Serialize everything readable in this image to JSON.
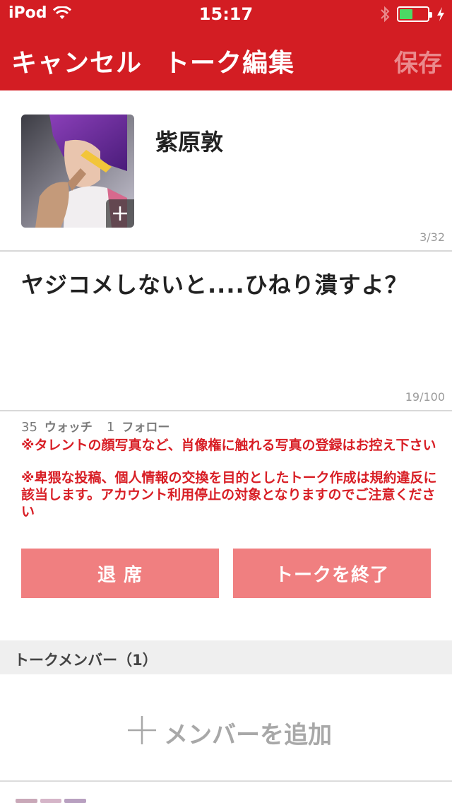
{
  "status_bar": {
    "carrier": "iPod",
    "time": "15:17",
    "wifi_icon": "wifi-icon",
    "bluetooth_icon": "bluetooth-icon",
    "battery_icon": "battery-icon",
    "charging_icon": "charging-bolt-icon"
  },
  "nav": {
    "cancel_label": "キャンセル",
    "title": "トーク編集",
    "save_label": "保存"
  },
  "profile": {
    "name": "紫原敦",
    "name_count": "3/32",
    "avatar_add_icon": "plus-icon"
  },
  "talk": {
    "text": "ヤジコメしないと....ひねり潰すよ？",
    "count": "19/100"
  },
  "stats": {
    "watch_count": "35",
    "watch_label": "ウォッチ",
    "follow_count": "1",
    "follow_label": "フォロー"
  },
  "notices": [
    "※タレントの顔写真など、肖像権に触れる写真の登録はお控え下さい",
    "※卑猥な投稿、個人情報の交換を目的としたトーク作成は規約違反に該当します。アカウント利用停止の対象となりますのでご注意ください"
  ],
  "buttons": {
    "leave_label": "退 席",
    "end_label": "トークを終了"
  },
  "members": {
    "header": "トークメンバー（1）",
    "add_label": "メンバーを追加",
    "add_icon": "plus-icon"
  },
  "colors": {
    "brand": "#d31d23",
    "button": "#f07f80",
    "save_disabled": "#ea8a8d",
    "notice": "#d81e25"
  }
}
